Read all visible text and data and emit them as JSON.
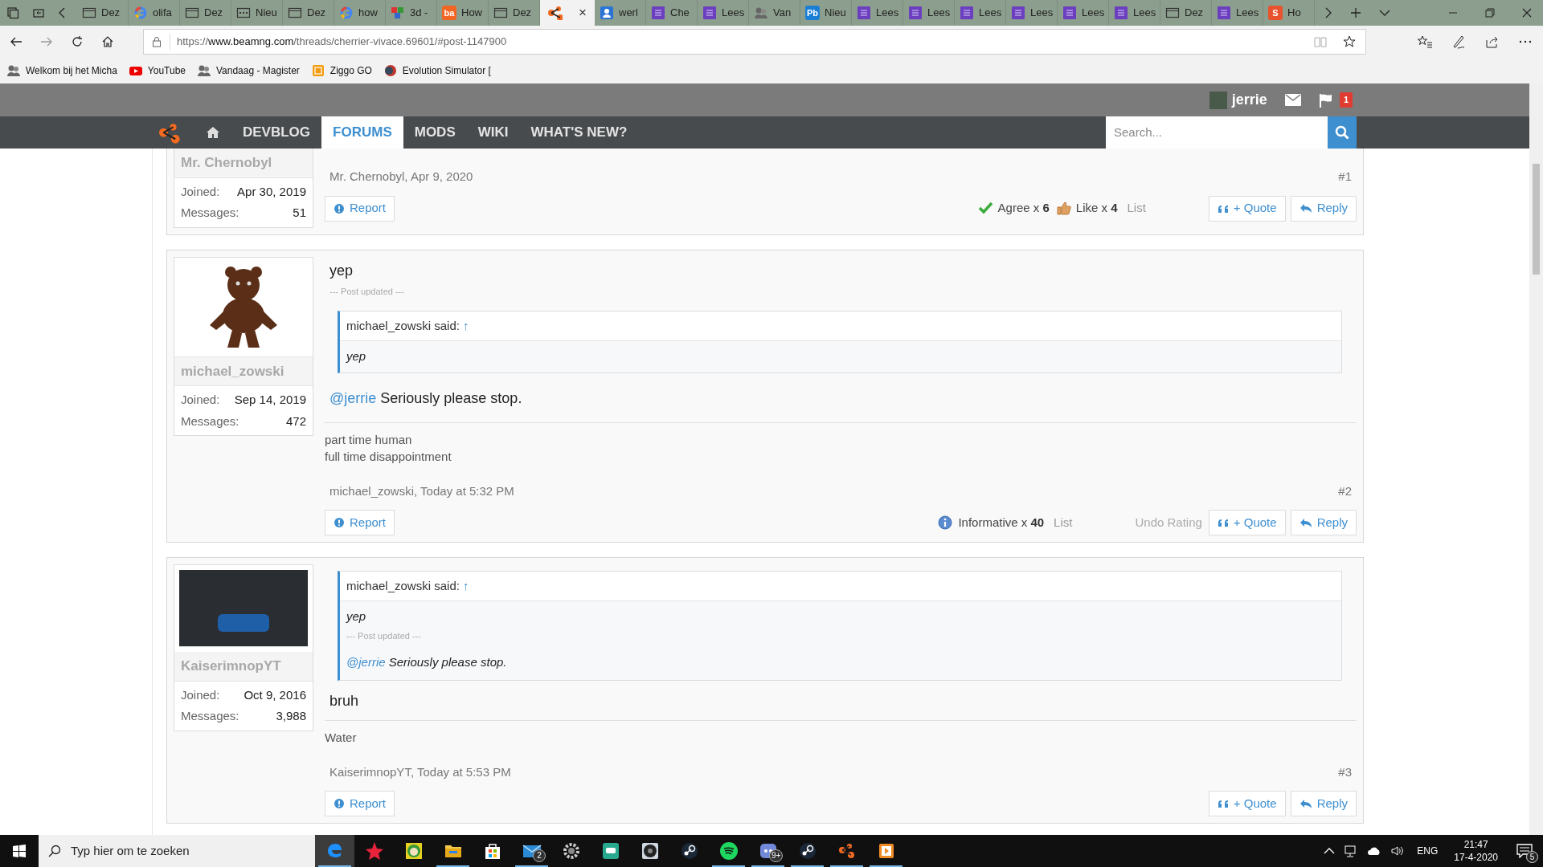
{
  "browser": {
    "tabs": [
      {
        "label": "Dez",
        "selected": false
      },
      {
        "label": "olifa",
        "selected": false
      },
      {
        "label": "Dez",
        "selected": false
      },
      {
        "label": "Nieu",
        "selected": false
      },
      {
        "label": "Dez",
        "selected": false
      },
      {
        "label": "how",
        "selected": false
      },
      {
        "label": "3d -",
        "selected": false
      },
      {
        "icon_text": "ba",
        "label": "How",
        "selected": false
      },
      {
        "label": "Dez",
        "selected": false
      },
      {
        "close": "×",
        "selected": true
      },
      {
        "label": "werl",
        "selected": false
      },
      {
        "label": "Che",
        "selected": false
      },
      {
        "label": "Lees",
        "selected": false
      },
      {
        "label": "Van",
        "selected": false
      },
      {
        "icon_text": "Pb",
        "label": "Nieu",
        "selected": false
      },
      {
        "label": "Lees",
        "selected": false
      },
      {
        "label": "Lees",
        "selected": false
      },
      {
        "label": "Lees",
        "selected": false
      },
      {
        "label": "Lees",
        "selected": false
      },
      {
        "label": "Lees",
        "selected": false
      },
      {
        "label": "Lees",
        "selected": false
      },
      {
        "label": "Dez",
        "selected": false
      },
      {
        "label": "Lees",
        "selected": false
      },
      {
        "icon_text": "S",
        "label": "Ho",
        "selected": false
      }
    ],
    "url": {
      "scheme": "https://",
      "domain": "www.beamng.com",
      "path": "/threads/cherrier-vivace.69601/#post-1147900"
    },
    "bookmarks": [
      {
        "label": "Welkom bij het Micha"
      },
      {
        "label": "YouTube"
      },
      {
        "label": "Vandaag - Magister"
      },
      {
        "label": "Ziggo GO"
      },
      {
        "label": "Evolution Simulator ["
      }
    ]
  },
  "forum": {
    "user": {
      "name": "jerrie"
    },
    "alerts": "1",
    "nav": [
      {
        "kind": "home",
        "selected": false
      },
      {
        "kind": "text",
        "label": "DEVBLOG",
        "selected": false
      },
      {
        "kind": "text",
        "label": "FORUMS",
        "selected": true
      },
      {
        "kind": "text",
        "label": "MODS",
        "selected": false
      },
      {
        "kind": "text",
        "label": "WIKI",
        "selected": false
      },
      {
        "kind": "text",
        "label": "WHAT'S NEW?",
        "selected": false
      }
    ],
    "search": {
      "placeholder": "Search..."
    }
  },
  "posts": [
    {
      "author": {
        "name": "Mr. Chernobyl",
        "stats": [
          {
            "label": "Joined:",
            "value": "Apr 30, 2019"
          },
          {
            "label": "Messages:",
            "value": "51"
          }
        ]
      },
      "meta": "Mr. Chernobyl, Apr 9, 2020",
      "number": "#1",
      "ratings": [
        {
          "kind": "agree",
          "label": "Agree x",
          "count": "6"
        },
        {
          "kind": "like",
          "label": "Like x",
          "count": "4"
        }
      ],
      "ratings_list": "List",
      "actions": {
        "report": "Report",
        "quote": "+ Quote",
        "reply": "Reply"
      }
    },
    {
      "author": {
        "name": "michael_zowski",
        "stats": [
          {
            "label": "Joined:",
            "value": "Sep 14, 2019"
          },
          {
            "label": "Messages:",
            "value": "472"
          }
        ]
      },
      "blocks": [
        {
          "kind": "text",
          "text": "yep"
        },
        {
          "kind": "separator",
          "text": "--- Post updated ---"
        },
        {
          "kind": "quote",
          "author": "michael_zowski said:",
          "arrow": "↑",
          "lines": [
            {
              "kind": "text",
              "text": "yep"
            }
          ]
        },
        {
          "kind": "mention",
          "mention": "@jerrie",
          "text": "Seriously please stop."
        }
      ],
      "signature": [
        "part time human",
        "full time disappointment"
      ],
      "meta": "michael_zowski, Today at 5:32 PM",
      "number": "#2",
      "ratings": [
        {
          "kind": "informative",
          "label": "Informative x",
          "count": "40"
        }
      ],
      "ratings_list": "List",
      "undo": "Undo Rating",
      "actions": {
        "report": "Report",
        "quote": "+ Quote",
        "reply": "Reply"
      }
    },
    {
      "author": {
        "name": "KaiserimnopYT",
        "stats": [
          {
            "label": "Joined:",
            "value": "Oct 9, 2016"
          },
          {
            "label": "Messages:",
            "value": "3,988"
          }
        ]
      },
      "blocks": [
        {
          "kind": "quote",
          "author": "michael_zowski said:",
          "arrow": "↑",
          "lines": [
            {
              "kind": "text",
              "text": "yep"
            },
            {
              "kind": "separator",
              "text": "--- Post updated ---"
            },
            {
              "kind": "mention",
              "mention": "@jerrie",
              "text": "Seriously please stop."
            }
          ]
        },
        {
          "kind": "text",
          "text": "bruh"
        }
      ],
      "signature": [
        "Water"
      ],
      "meta": "KaiserimnopYT, Today at 5:53 PM",
      "number": "#3",
      "actions": {
        "report": "Report",
        "quote": "+ Quote",
        "reply": "Reply"
      }
    }
  ],
  "taskbar": {
    "search": {
      "placeholder": "Typ hier om te zoeken"
    },
    "apps": [
      {
        "running": true,
        "active": true
      },
      {
        "running": false,
        "active": false
      },
      {
        "running": false,
        "active": false
      },
      {
        "running": true,
        "active": false
      },
      {
        "running": false,
        "active": false
      },
      {
        "running": true,
        "active": false,
        "badge": "2"
      },
      {
        "running": false,
        "active": false
      },
      {
        "running": false,
        "active": false
      },
      {
        "running": false,
        "active": false
      },
      {
        "running": false,
        "active": false
      },
      {
        "running": true,
        "active": false
      },
      {
        "running": true,
        "active": false,
        "badge": "9+"
      },
      {
        "running": true,
        "active": false
      },
      {
        "running": true,
        "active": false
      },
      {
        "running": true,
        "active": false
      }
    ],
    "language": "ENG",
    "time": "21:47",
    "date": "17-4-2020",
    "notifications": "5"
  }
}
